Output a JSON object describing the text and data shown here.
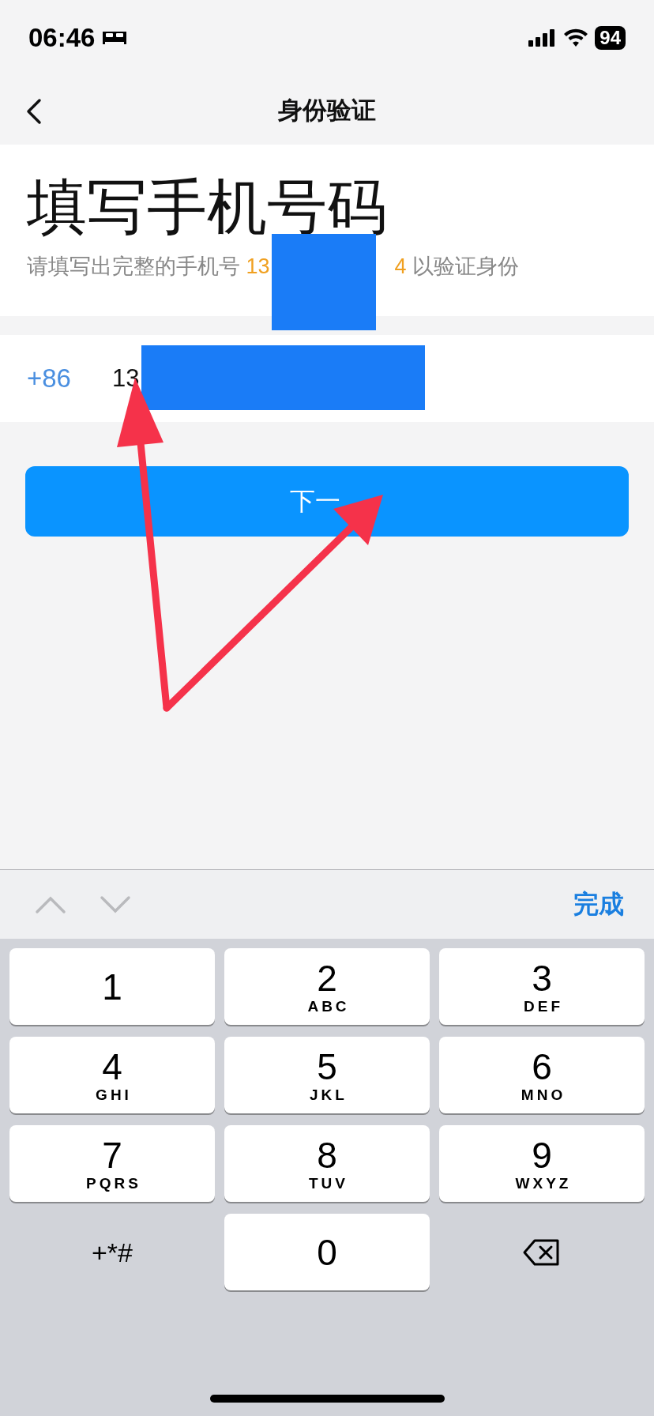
{
  "status_bar": {
    "time": "06:46",
    "battery": "94"
  },
  "nav": {
    "title": "身份验证"
  },
  "heading": "填写手机号码",
  "subtitle": {
    "before": "请填写出完整的手机号 ",
    "highlight_start": "13",
    "highlight_end": "4",
    "after": " 以验证身份"
  },
  "phone": {
    "country_code": "+86",
    "value": "13"
  },
  "next_button": "下一",
  "toolbar": {
    "prev_disabled": true,
    "next_disabled": true,
    "done": "完成"
  },
  "keys": [
    {
      "kind": "digit",
      "digit": "1"
    },
    {
      "kind": "digit",
      "digit": "2",
      "letters": "ABC"
    },
    {
      "kind": "digit",
      "digit": "3",
      "letters": "DEF"
    },
    {
      "kind": "digit",
      "digit": "4",
      "letters": "GHI"
    },
    {
      "kind": "digit",
      "digit": "5",
      "letters": "JKL"
    },
    {
      "kind": "digit",
      "digit": "6",
      "letters": "MNO"
    },
    {
      "kind": "digit",
      "digit": "7",
      "letters": "PQRS"
    },
    {
      "kind": "digit",
      "digit": "8",
      "letters": "TUV"
    },
    {
      "kind": "digit",
      "digit": "9",
      "letters": "WXYZ"
    },
    {
      "kind": "symbols",
      "digit": "+*#"
    },
    {
      "kind": "digit",
      "digit": "0"
    },
    {
      "kind": "delete"
    }
  ]
}
